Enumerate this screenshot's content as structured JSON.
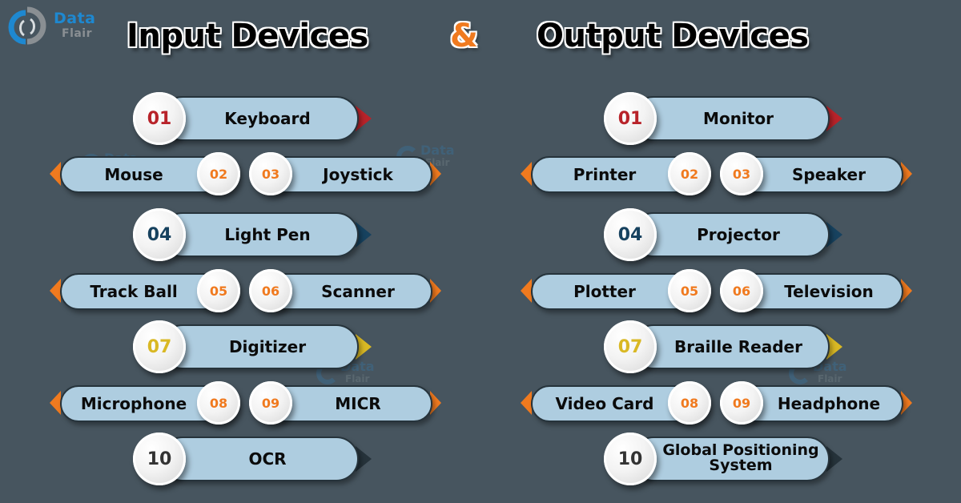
{
  "brand": {
    "name_line1": "Data",
    "name_line2": "Flair",
    "icon": "dataflair-logo-icon"
  },
  "header": {
    "left_title": "Input Devices",
    "ampersand": "&",
    "right_title": "Output Devices"
  },
  "colors": {
    "background": "#47555f",
    "pill_fill": "#aecde0",
    "red": "#b8232a",
    "orange": "#f07a1f",
    "navy": "#17425f",
    "yellow": "#d9b824",
    "dark": "#26333b",
    "number_gray": "#333333"
  },
  "input_devices": [
    {
      "num": "01",
      "label": "Keyboard"
    },
    {
      "num": "02",
      "label": "Mouse"
    },
    {
      "num": "03",
      "label": "Joystick"
    },
    {
      "num": "04",
      "label": "Light Pen"
    },
    {
      "num": "05",
      "label": "Track Ball"
    },
    {
      "num": "06",
      "label": "Scanner"
    },
    {
      "num": "07",
      "label": "Digitizer"
    },
    {
      "num": "08",
      "label": "Microphone"
    },
    {
      "num": "09",
      "label": "MICR"
    },
    {
      "num": "10",
      "label": "OCR"
    }
  ],
  "output_devices": [
    {
      "num": "01",
      "label": "Monitor"
    },
    {
      "num": "02",
      "label": "Printer"
    },
    {
      "num": "03",
      "label": "Speaker"
    },
    {
      "num": "04",
      "label": "Projector"
    },
    {
      "num": "05",
      "label": "Plotter"
    },
    {
      "num": "06",
      "label": "Television"
    },
    {
      "num": "07",
      "label": "Braille Reader"
    },
    {
      "num": "08",
      "label": "Video Card"
    },
    {
      "num": "09",
      "label": "Headphone"
    },
    {
      "num": "10",
      "label": "Global Positioning System"
    }
  ]
}
